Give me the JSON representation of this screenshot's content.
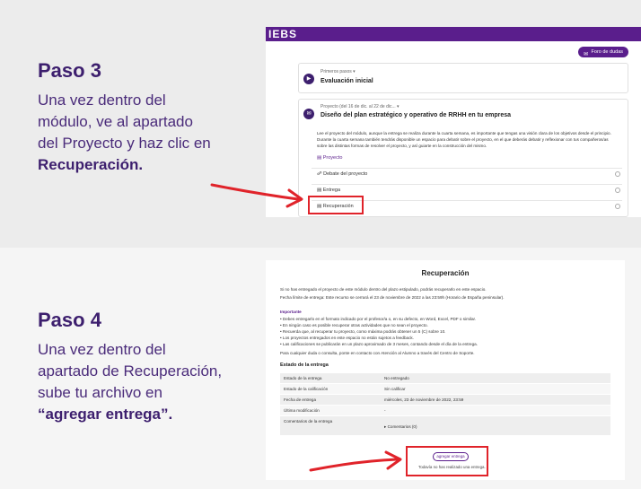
{
  "step3": {
    "title": "Paso 3",
    "line1": "Una vez dentro del",
    "line2": "módulo, ve al apartado",
    "line3": "del Proyecto y haz clic en",
    "line4": "Recuperación."
  },
  "step4": {
    "title": "Paso 4",
    "line1": "Una vez dentro del",
    "line2": "apartado de Recuperación,",
    "line3": "sube tu archivo en",
    "line4": "“agregar entrega”."
  },
  "shot1": {
    "logo": "IEBS",
    "forum_button": "Foro de dudas",
    "card1": {
      "meta": "Primeros pasos ▾",
      "title": "Evaluación inicial"
    },
    "card2": {
      "meta": "Proyecto (del 16 de dic. al 22 de dic... ▾",
      "title": "Diseño del plan estratégico y operativo de RRHH en tu empresa",
      "desc": "Lee el proyecto del módulo, aunque la entrega se realiza durante la cuarta semana, es importante que tengas una visión clara de los objetivos desde el principio. Durante la cuarta semana también tendrás disponible un espacio para debatir sobre el proyecto, en el que deberás debatir y reflexionar con tus compañeros/as sobre las distintas formas de resolver el proyecto, y así guiarte en la construcción del mismo.",
      "proyecto_link": "Proyecto",
      "rows": [
        "Debate del proyecto",
        "Entrega",
        "Recuperación"
      ]
    }
  },
  "shot2": {
    "title": "Recuperación",
    "intro": "Si no has entregado el proyecto de este módulo dentro del plazo estipulado, podrás recuperarlo en este espacio.",
    "deadline": "Fecha límite de entrega: Este recurso se cerrará el 23 de noviembre de 2022 a las 23:59h (Horario de España peninsular).",
    "important": "Importante",
    "bullets": [
      "• Debes entregarlo en el formato indicado por el profesor/a o, en su defecto, en Word, Excel, PDF o similar.",
      "• En ningún caso es posible recuperar otras actividades que no sean el proyecto.",
      "• Recuerda que, al recuperar tu proyecto, como máxima podrás obtener un 5 (C) sobre 10.",
      "• Los proyectos entregados en este espacio no están sujetos a feedback.",
      "• Las calificaciones se publicarán en un plazo aproximado de 3 meses, contando desde el día de la entrega."
    ],
    "contact": "Para cualquier duda o consulta, ponte en contacto con Atención al Alumno a través del Centro de Soporte.",
    "status_heading": "Estado de la entrega",
    "table": [
      {
        "k": "Estado de la entrega",
        "v": "No entregado"
      },
      {
        "k": "Estado de la calificación",
        "v": "Sin calificar"
      },
      {
        "k": "Fecha de entrega",
        "v": "miércoles, 23 de noviembre de 2022, 23:59"
      },
      {
        "k": "Última modificación",
        "v": "-"
      },
      {
        "k": "Comentarios de la entrega",
        "v": "▸ Comentarios (0)"
      }
    ],
    "add_button": "agregar entrega",
    "note": "Todavía no has realizado una entrega."
  },
  "colors": {
    "brand": "#5a1e8c",
    "title": "#3d1f6e",
    "highlight": "#e0232a"
  }
}
